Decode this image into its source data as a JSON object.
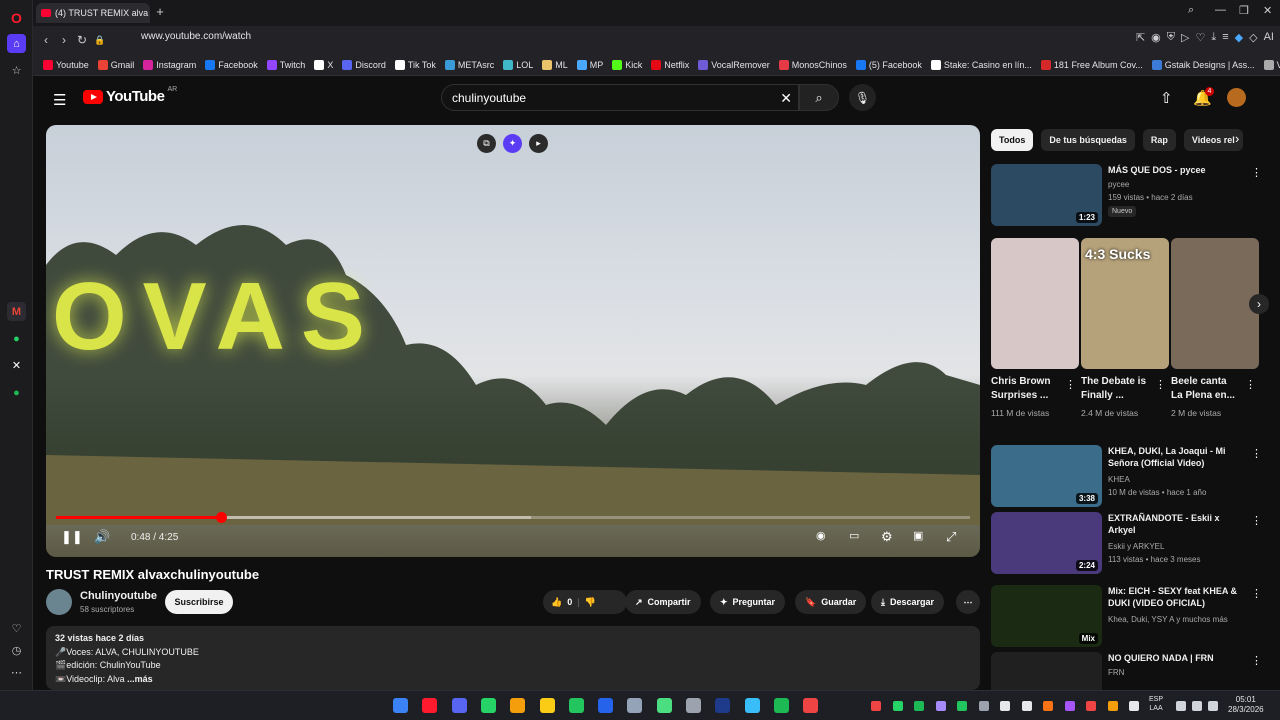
{
  "browser": {
    "tab_title": "(4) TRUST REMIX alva",
    "url": "www.youtube.com/watch",
    "bookmarks": [
      {
        "label": "Youtube",
        "color": "#ff0033"
      },
      {
        "label": "Gmail",
        "color": "#ea4335"
      },
      {
        "label": "Instagram",
        "color": "#d6249f"
      },
      {
        "label": "Facebook",
        "color": "#1877f2"
      },
      {
        "label": "Twitch",
        "color": "#9146ff"
      },
      {
        "label": "X",
        "color": "#ffffff"
      },
      {
        "label": "Discord",
        "color": "#5865f2"
      },
      {
        "label": "Tik Tok",
        "color": "#ffffff"
      },
      {
        "label": "METAsrc",
        "color": "#3a9bd8"
      },
      {
        "label": "LOL",
        "color": "#3fb7c9"
      },
      {
        "label": "ML",
        "color": "#e9c46a"
      },
      {
        "label": "MP",
        "color": "#4aa8ff"
      },
      {
        "label": "Kick",
        "color": "#53fc18"
      },
      {
        "label": "Netflix",
        "color": "#e50914"
      },
      {
        "label": "VocalRemover",
        "color": "#6f5bd6"
      },
      {
        "label": "MonosChinos",
        "color": "#e63946"
      },
      {
        "label": "(5) Facebook",
        "color": "#1877f2"
      },
      {
        "label": "Stake: Casino en lín...",
        "color": "#ffffff"
      },
      {
        "label": "181 Free Album Cov...",
        "color": "#d62828"
      },
      {
        "label": "Gstaik Designs | Ass...",
        "color": "#3d7bd8"
      },
      {
        "label": "Venex",
        "color": "#aaaaaa"
      }
    ]
  },
  "youtube": {
    "logo": "YouTube",
    "region": "AR",
    "search_query": "chulinyoutube",
    "notification_count": "4"
  },
  "video": {
    "overlay_text": "OVAS",
    "current_time": "0:48",
    "duration": "4:25",
    "time_display": "0:48 / 4:25",
    "progress": 0.181,
    "buffered": 0.52,
    "title": "TRUST REMIX alvaxchulinyoutube",
    "channel": "Chulinyoutube",
    "subscribers": "58 suscriptores",
    "subscribe_label": "Suscribirse",
    "likes": "0",
    "share_label": "Compartir",
    "ask_label": "Preguntar",
    "save_label": "Guardar",
    "download_label": "Descargar",
    "description": {
      "stats": "32 vistas  hace 2 días",
      "line1": "🎤Voces: ALVA, CHULINYOUTUBE",
      "line2": "🎬edición: ChulinYouTube",
      "line3": "📼Videoclip: Alva",
      "more": "...más"
    }
  },
  "sidebar": {
    "chips": [
      "Todos",
      "De tus búsquedas",
      "Rap",
      "Videos rel"
    ],
    "recs": [
      {
        "title": "MÁS QUE DOS - pycee",
        "channel": "pycee",
        "meta": "159 vistas • hace 2 días",
        "duration": "1:23",
        "badge": "Nuevo",
        "thumb": "#2d4a63"
      },
      {
        "title": "KHEA, DUKI, La Joaqui - Mi Señora (Official Video)",
        "channel": "KHEA",
        "meta": "10 M de vistas • hace 1 año",
        "duration": "3:38",
        "thumb": "#3b6d8a"
      },
      {
        "title": "EXTRAÑANDOTE - Eskii x Arkyel",
        "channel": "Eskii y ARKYEL",
        "meta": "113 vistas • hace 3 meses",
        "duration": "2:24",
        "thumb": "#4a3a7c"
      },
      {
        "title": "Mix: EICH - SEXY feat KHEA & DUKI  (VIDEO OFICIAL)",
        "channel": "Khea, Duki, YSY A y muchos más",
        "meta": "",
        "duration": "Mix",
        "thumb": "#1b2a12"
      },
      {
        "title": "NO QUIERO NADA | FRN",
        "channel": "FRN",
        "meta": "",
        "duration": "",
        "thumb": "#202020"
      }
    ],
    "shorts": [
      {
        "title": "Chris Brown Surprises ...",
        "views": "111 M de vistas",
        "thumb": "#d8c7c7"
      },
      {
        "title": "The Debate is Finally ...",
        "views": "2.4 M de vistas",
        "thumb": "#b5a27a",
        "overlay": "4:3 Sucks"
      },
      {
        "title": "Beele canta La Plena en...",
        "views": "2 M de vistas",
        "thumb": "#7a6a5a"
      }
    ]
  },
  "system": {
    "lang": "ESP",
    "lang2": "LAA",
    "time": "05:01",
    "date": "28/3/2026"
  }
}
